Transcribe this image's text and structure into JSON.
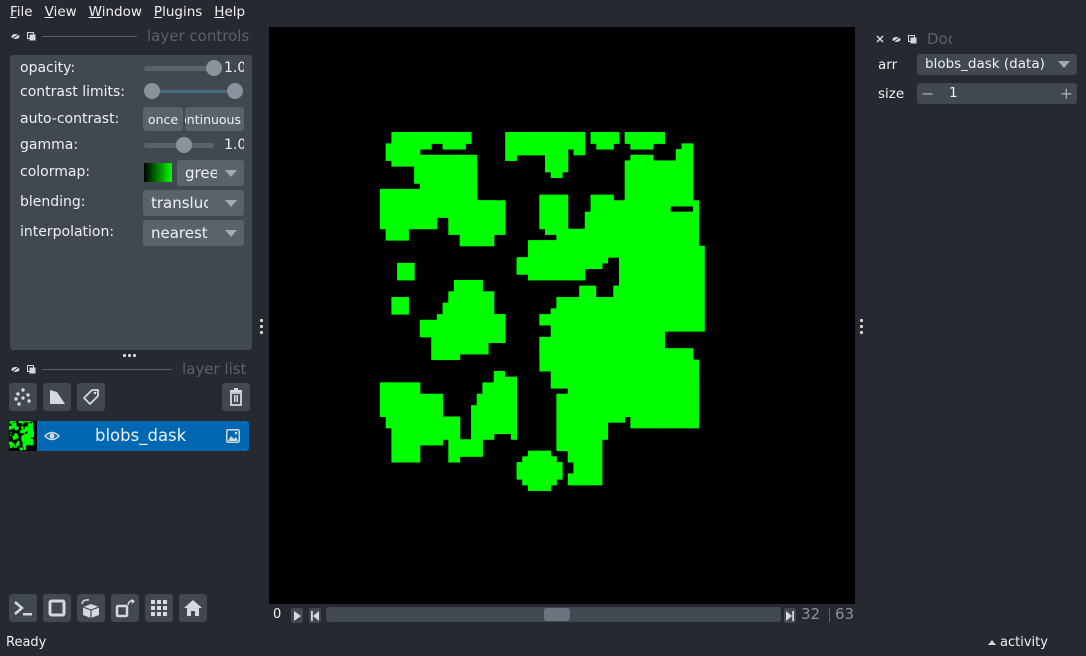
{
  "menubar": {
    "items": [
      {
        "label": "File",
        "mnemonic": "F",
        "rest": "ile"
      },
      {
        "label": "View",
        "mnemonic": "V",
        "rest": "iew"
      },
      {
        "label": "Window",
        "mnemonic": "W",
        "rest": "indow"
      },
      {
        "label": "Plugins",
        "mnemonic": "P",
        "rest": "lugins"
      },
      {
        "label": "Help",
        "mnemonic": "H",
        "rest": "elp"
      }
    ]
  },
  "layer_controls": {
    "title": "layer controls",
    "opacity": {
      "label": "opacity:",
      "value": "1.0",
      "fraction": 1.0
    },
    "contrast_limits": {
      "label": "contrast limits:",
      "low_fraction": 0.0,
      "high_fraction": 1.0
    },
    "auto_contrast": {
      "label": "auto-contrast:",
      "once_label": "once",
      "continuous_label": "continuous"
    },
    "gamma": {
      "label": "gamma:",
      "value": "1.0",
      "fraction": 0.5
    },
    "colormap": {
      "label": "colormap:",
      "value": "green",
      "gradient_from": "#000000",
      "gradient_to": "#00ff00"
    },
    "blending": {
      "label": "blending:",
      "value": "translucent"
    },
    "interpolation": {
      "label": "interpolation:",
      "value": "nearest"
    }
  },
  "layer_list": {
    "title": "layer list",
    "layers": [
      {
        "name": "blobs_dask",
        "visible": true,
        "type": "image",
        "selected": true,
        "selected_color": "#0068b3"
      }
    ]
  },
  "viewer": {
    "blob_color": "#00ff00",
    "background": "#000000"
  },
  "dims": {
    "start": "0",
    "current": "32",
    "max": "63",
    "position_fraction": 0.508
  },
  "dock_widget": {
    "title": "Doc",
    "arr_label": "arr",
    "arr_value": "blobs_dask (data)",
    "size_label": "size",
    "size_value": "1",
    "minus": "−",
    "plus": "+"
  },
  "status": {
    "text": "Ready",
    "activity_label": "activity"
  }
}
